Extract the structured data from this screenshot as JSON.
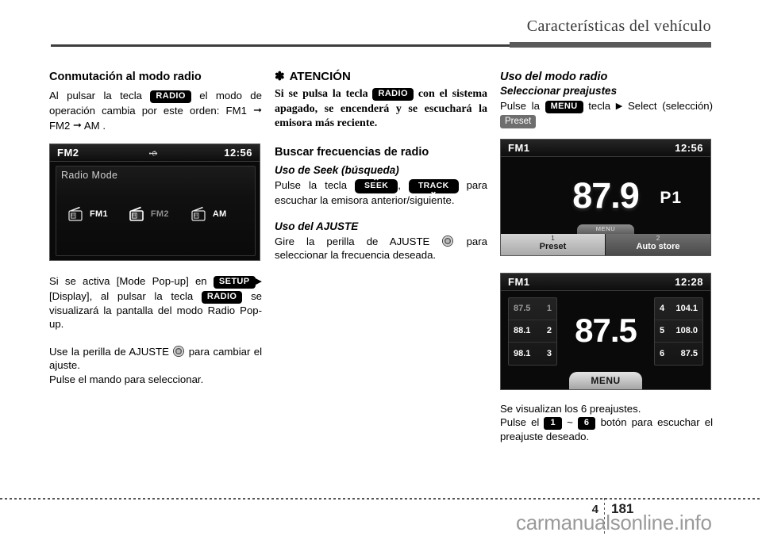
{
  "header": {
    "title": "Características del vehículo"
  },
  "col1": {
    "heading": "Conmutación al modo radio",
    "para1_a": "Al pulsar la tecla",
    "para1_key": "RADIO",
    "para1_b": "el modo de operación cambia por este orden: FM1",
    "para1_c": "FM2",
    "para1_d": "AM .",
    "screen": {
      "band": "FM2",
      "time": "12:56",
      "panel_title": "Radio Mode",
      "items": [
        {
          "label": "FM1",
          "selected": false
        },
        {
          "label": "FM2",
          "selected": true
        },
        {
          "label": "AM",
          "selected": false
        }
      ]
    },
    "para2_a": "Si se activa [Mode Pop-up] en",
    "para2_key1": "SETUP",
    "para2_b": "[Display], al pulsar la tecla",
    "para2_key2": "RADIO",
    "para2_c": "se visualizará la pantalla del modo Radio Pop-up.",
    "para3_a": "Use   la perilla de AJUSTE",
    "para3_b": "para cambiar el ajuste.",
    "para4": "Pulse el mando para seleccionar."
  },
  "col2": {
    "notice_asterisk": "✽",
    "notice_title": "ATENCIÓN",
    "notice_a": "Si se pulsa la tecla",
    "notice_key": "RADIO",
    "notice_b": "con el sistema apagado, se encenderá y se escuchará la emisora más reciente.",
    "heading": "Buscar frecuencias de radio",
    "sub1": "Uso de Seek (búsqueda)",
    "sub1_a": "Pulse la tecla",
    "sub1_key1": "SEEK",
    "sub1_key1_chevron": "⌃",
    "sub1_comma": ",",
    "sub1_key2": "TRACK",
    "sub1_key2_chevron": "⌄",
    "sub1_b": "para escuchar la emisora anterior/siguiente.",
    "sub2": "Uso del AJUSTE",
    "sub2_a": "Gire la perilla de AJUSTE",
    "sub2_b": "para seleccionar la frecuencia deseada."
  },
  "col3": {
    "heading": "Uso del modo radio",
    "sub1": "Seleccionar preajustes",
    "para1_a": "Pulse la",
    "para1_key": "MENU",
    "para1_b": "tecla",
    "para1_tri": "▶",
    "para1_c": "Select (selección)",
    "para1_badge": "Preset",
    "screen2": {
      "band": "FM1",
      "time": "12:56",
      "frequency": "87.9",
      "preset_label": "P1",
      "menu_tab": "MENU",
      "tabs": [
        {
          "num": "1",
          "label": "Preset",
          "active": true
        },
        {
          "num": "2",
          "label": "Auto store",
          "active": false
        }
      ]
    },
    "screen3": {
      "band": "FM1",
      "time": "12:28",
      "frequency": "87.5",
      "menu_tab": "MENU",
      "presets_left": [
        {
          "freq": "87.5",
          "num": "1",
          "dim": true
        },
        {
          "freq": "88.1",
          "num": "2",
          "dim": false
        },
        {
          "freq": "98.1",
          "num": "3",
          "dim": false
        }
      ],
      "presets_right": [
        {
          "num": "4",
          "freq": "104.1"
        },
        {
          "num": "5",
          "freq": "108.0"
        },
        {
          "num": "6",
          "freq": "87.5"
        }
      ]
    },
    "para2": "Se visualizan los 6 preajustes.",
    "para3_a": "Pulse el",
    "para3_key1": "1",
    "para3_tilde": "~",
    "para3_key2": "6",
    "para3_b": "botón para escuchar el preajuste deseado."
  },
  "footer": {
    "chapter": "4",
    "page": "181",
    "watermark": "carmanualsonline.info"
  }
}
